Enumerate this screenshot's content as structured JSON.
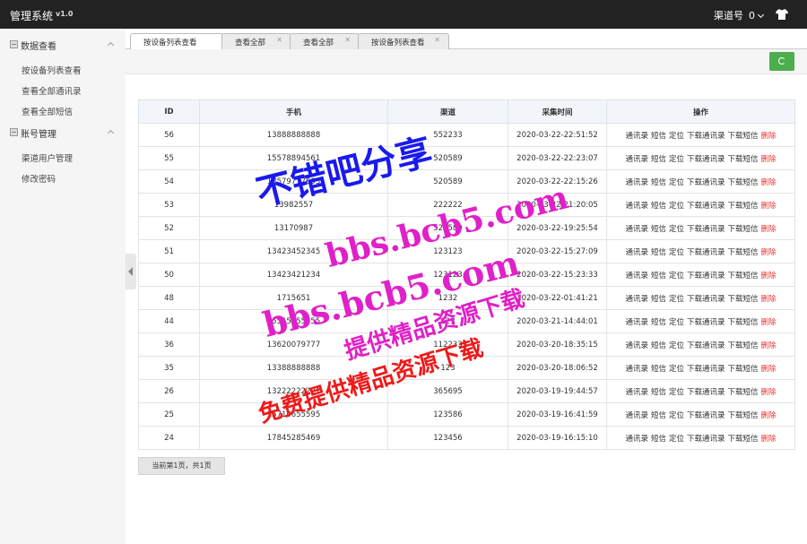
{
  "app": {
    "title": "管理系统",
    "version": "v1.0"
  },
  "header": {
    "user_label": "渠道号",
    "user_count": "0"
  },
  "sidebar": {
    "groups": [
      {
        "label": "数据查看",
        "items": [
          "按设备列表查看",
          "查看全部通讯录",
          "查看全部短信"
        ]
      },
      {
        "label": "账号管理",
        "items": [
          "渠道用户管理",
          "修改密码"
        ]
      }
    ]
  },
  "tabs": [
    {
      "label": "按设备列表查看",
      "active": true
    },
    {
      "label": "查看全部",
      "active": false
    },
    {
      "label": "查看全部",
      "active": false
    },
    {
      "label": "按设备列表查看",
      "active": false
    }
  ],
  "colors": {
    "topbar": "#222222",
    "refresh": "#4cae4c",
    "delete": "#ee3333",
    "header_row": "#f2f6fa"
  },
  "table": {
    "columns": [
      "ID",
      "手机",
      "渠道",
      "采集时间",
      "操作"
    ],
    "actions": [
      "通讯录",
      "短信",
      "定位",
      "下载通讯录",
      "下载短信",
      "删除"
    ],
    "rows": [
      {
        "id": "56",
        "phone": "13888888888",
        "channel": "552233",
        "time": "2020-03-22-22:51:52"
      },
      {
        "id": "55",
        "phone": "15578894561",
        "channel": "520589",
        "time": "2020-03-22-22:23:07"
      },
      {
        "id": "54",
        "phone": "18579777603",
        "channel": "520589",
        "time": "2020-03-22-22:15:26"
      },
      {
        "id": "53",
        "phone": "13982557",
        "channel": "222222",
        "time": "2020-03-22-21:20:05"
      },
      {
        "id": "52",
        "phone": "13170987",
        "channel": "520589",
        "time": "2020-03-22-19:25:54"
      },
      {
        "id": "51",
        "phone": "13423452345",
        "channel": "123123",
        "time": "2020-03-22-15:27:09"
      },
      {
        "id": "50",
        "phone": "13423421234",
        "channel": "123123",
        "time": "2020-03-22-15:23:33"
      },
      {
        "id": "48",
        "phone": "1715651",
        "channel": "1232",
        "time": "2020-03-22-01:41:21"
      },
      {
        "id": "44",
        "phone": "15555555555",
        "channel": "123",
        "time": "2020-03-21-14:44:01"
      },
      {
        "id": "36",
        "phone": "13620079777",
        "channel": "112233",
        "time": "2020-03-20-18:35:15"
      },
      {
        "id": "35",
        "phone": "13388888888",
        "channel": "123",
        "time": "2020-03-20-18:06:52"
      },
      {
        "id": "26",
        "phone": "13222222221",
        "channel": "365695",
        "time": "2020-03-19-19:44:57"
      },
      {
        "id": "25",
        "phone": "15710655595",
        "channel": "123586",
        "time": "2020-03-19-16:41:59"
      },
      {
        "id": "24",
        "phone": "17845285469",
        "channel": "123456",
        "time": "2020-03-19-16:15:10"
      }
    ]
  },
  "pager": {
    "text": "当前第1页，共1页"
  },
  "watermark": {
    "line1": "不错吧分享",
    "line2": "bbs.bcb5.com",
    "line3": "bbs.bcb5.com",
    "line4": "提供精品资源下载",
    "line5": "免费提供精品资源下载"
  }
}
